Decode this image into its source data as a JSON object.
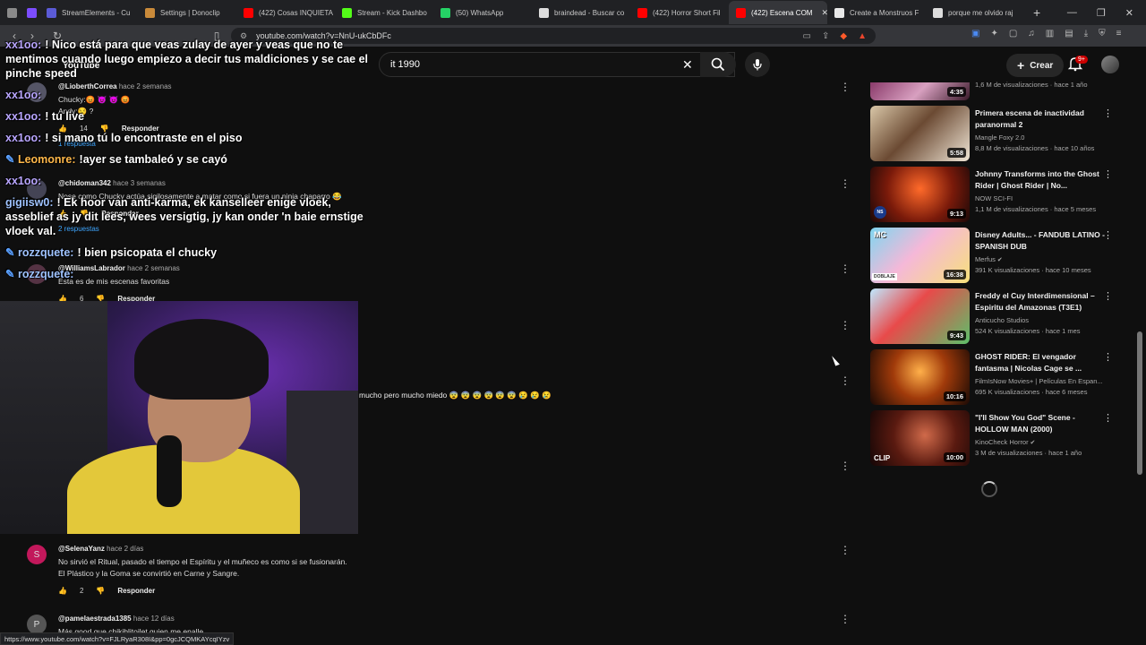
{
  "browser": {
    "tabs": [
      {
        "title": "",
        "color": "#8a8a8a"
      },
      {
        "title": "",
        "color": "#7c4dff"
      },
      {
        "title": "StreamElements - Cu",
        "color": "#5b5bd6"
      },
      {
        "title": "Settings | Donoclip",
        "color": "#c98a3a"
      },
      {
        "title": "(422) Cosas INQUIETA",
        "color": "#ff0000"
      },
      {
        "title": "Stream - Kick Dashbo",
        "color": "#53fc18"
      },
      {
        "title": "(50) WhatsApp",
        "color": "#25d366"
      },
      {
        "title": "braindead - Buscar co",
        "color": "#dddddd"
      },
      {
        "title": "(422) Horror Short Fil",
        "color": "#ff0000"
      },
      {
        "title": "(422) Escena COM",
        "color": "#ff0000"
      },
      {
        "title": "Create a Monstruos F",
        "color": "#e8e8e8"
      },
      {
        "title": "porque me olvido raj",
        "color": "#dddddd"
      }
    ],
    "active_tab_index": 9,
    "url": "youtube.com/watch?v=NnU-ukCbDFc",
    "status_url": "https://www.youtube.com/watch?v=FJLRyaR308I&pp=0gcJCQMKAYcqIYzv"
  },
  "youtube": {
    "logo_text": "YouTube",
    "search_value": "it 1990",
    "create_label": "Crear",
    "notification_count": "9+"
  },
  "chat": [
    {
      "user": "xx1oo:",
      "user_color": "purple",
      "message": "! Nico está para que veas zulay de ayer y veas que no te mentimos cuando luego empiezo a decir tus maldiciones y se cae el pinche speed",
      "badge": false
    },
    {
      "user": "xx1oo:",
      "user_color": "purple",
      "message": "",
      "badge": false
    },
    {
      "user": "xx1oo:",
      "user_color": "purple",
      "message": "! tu live",
      "badge": false
    },
    {
      "user": "xx1oo:",
      "user_color": "purple",
      "message": "! si mano tú lo encontraste en el piso",
      "badge": false
    },
    {
      "user": "Leomonre:",
      "user_color": "orange",
      "message": "!ayer se tambaleó y se cayó",
      "badge": true
    },
    {
      "user": "xx1oo:",
      "user_color": "purple",
      "message": "",
      "badge": false
    },
    {
      "user": "gigiisw0:",
      "user_color": "blue",
      "message": "! Ek hoor van anti-karma, ek kanselleer enige vloek, asseblief as jy dit lees, wees versigtig, jy kan onder 'n baie ernstige vloek val.",
      "badge": false
    },
    {
      "user": "rozzquete:",
      "user_color": "blue",
      "message": "! bien psicopata el chucky",
      "badge": true
    },
    {
      "user": "rozzquete:",
      "user_color": "blue",
      "message": "",
      "badge": true
    }
  ],
  "comments": {
    "c1": {
      "handle": "@LioberthCorrea",
      "time": "hace 2 semanas",
      "text": "Chucky:😡 😈 😈 😡",
      "text2": "Andy:😒 ?",
      "likes": "14",
      "reply": "Responder",
      "replies": "1 respuesta"
    },
    "c2": {
      "handle": "@chidoman342",
      "time": "hace 3 semanas",
      "text": "Nose como Chucky actúa sigilosamente a matar como si fuera un ninja chaparro 😂",
      "reply": "Responder",
      "replies": "2 respuestas"
    },
    "c3": {
      "handle": "@WilliamsLabrador",
      "time": "hace 2 semanas",
      "text": "Esta es de mis escenas favoritas",
      "likes": "6",
      "reply": "Responder"
    },
    "c4": {
      "text": "mucho pero mucho miedo 😨 😨 😨 😨 😨 😨 😢 😢 😢"
    },
    "c5": {
      "avatar_letter": "S",
      "handle": "@SelenaYanz",
      "time": "hace 2 días",
      "text": "No sirvió el Ritual, pasado el tiempo el Espíritu y el muñeco es como si se fusionarán.",
      "text2": "El Plástico y la Goma se convirtió en Carne y Sangre.",
      "likes": "2",
      "reply": "Responder"
    },
    "c6": {
      "avatar_letter": "P",
      "handle": "@pamelaestrada1385",
      "time": "hace 12 días",
      "text": "Más good que chikiblitoilet quien me enalle"
    }
  },
  "recommendations": [
    {
      "title": "",
      "channel": "",
      "meta": "1,6 M de visualizaciones · hace 1 año",
      "duration": "4:35",
      "verified": false,
      "thumb": "linear-gradient(135deg,#8a3a6a,#d8a0c0 50%,#3a1a2a)"
    },
    {
      "title": "Primera escena de inactividad paranormal 2",
      "channel": "Mangle Foxy 2.0",
      "meta": "8,8 M de visualizaciones · hace 10 años",
      "duration": "5:58",
      "verified": false,
      "thumb": "linear-gradient(135deg,#d9c7a8,#6b4a33 45%,#f0e6d6)"
    },
    {
      "title": "Johnny Transforms into the Ghost Rider | Ghost Rider | No...",
      "channel": "NOW SCI-FI",
      "meta": "1,1 M de visualizaciones · hace 5 meses",
      "duration": "9:13",
      "verified": false,
      "thumb": "radial-gradient(circle at 50% 40%,#ff6a2a,#7a1a0a 55%,#1a0808)"
    },
    {
      "title": "Disney Adults... - FANDUB LATINO - SPANISH DUB",
      "channel": "Merfus",
      "meta": "391 K visualizaciones · hace 10 meses",
      "duration": "16:38",
      "verified": true,
      "thumb": "linear-gradient(135deg,#7fd6f0,#f5b8d8 45%,#f7e07a)"
    },
    {
      "title": "Freddy el Cuy Interdimensional – Espiritu del Amazonas (T3E1)",
      "channel": "Anticucho Studios",
      "meta": "524 K visualizaciones · hace 1 mes",
      "duration": "9:43",
      "verified": false,
      "thumb": "linear-gradient(135deg,#bfe9ff,#e84a4a 40%,#5cc06a)"
    },
    {
      "title": "GHOST RIDER: El vengador fantasma | Nicolas Cage se ...",
      "channel": "FilmIsNow Movies+ | Películas En Espan...",
      "meta": "695 K visualizaciones · hace 6 meses",
      "duration": "10:16",
      "verified": false,
      "thumb": "radial-gradient(circle at 50% 40%,#ffb04a,#a03a0a 45%,#1a0a05)"
    },
    {
      "title": "\"I'll Show You God\" Scene - HOLLOW MAN (2000)",
      "channel": "KinoCheck Horror",
      "meta": "3 M de visualizaciones · hace 1 año",
      "duration": "10:00",
      "verified": true,
      "thumb": "radial-gradient(circle at 55% 45%,#d06a4a,#5a1a10 50%,#140606)"
    }
  ],
  "clip_label": "CLIP",
  "thumb_labels": {
    "rec2": "NS",
    "rec3": "MC",
    "rec3b": "DOBLAJE"
  }
}
